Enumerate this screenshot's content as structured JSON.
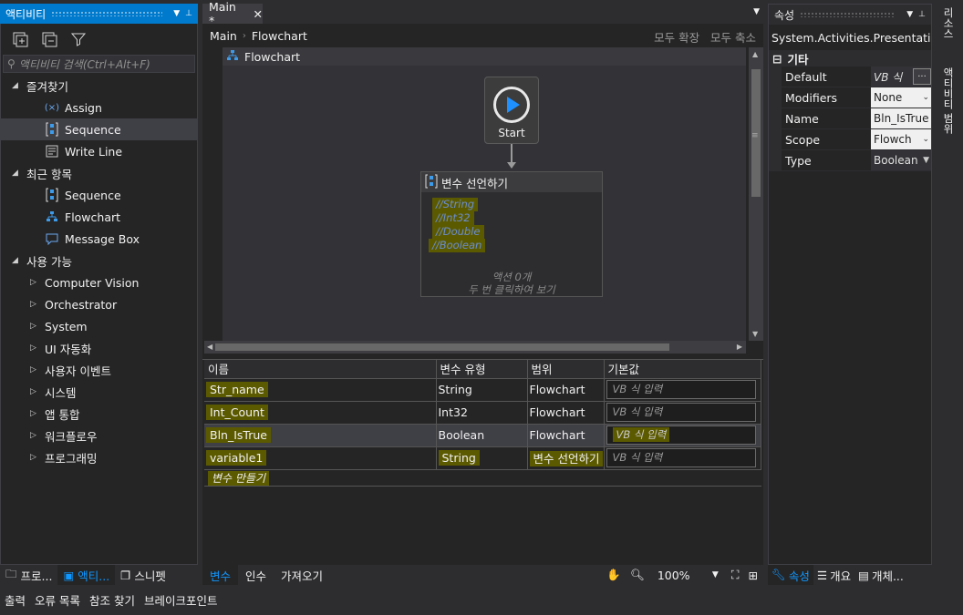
{
  "activities_panel": {
    "title": "액티비티",
    "search_placeholder": "액티비티 검색(Ctrl+Alt+F)",
    "tree": [
      {
        "type": "group",
        "label": "즐겨찾기",
        "expanded": true
      },
      {
        "type": "item",
        "icon": "assign-icon",
        "label": "Assign"
      },
      {
        "type": "item",
        "icon": "sequence-icon",
        "label": "Sequence",
        "selected": true
      },
      {
        "type": "item",
        "icon": "write-line-icon",
        "label": "Write Line"
      },
      {
        "type": "group",
        "label": "최근 항목",
        "expanded": true
      },
      {
        "type": "item",
        "icon": "sequence-icon",
        "label": "Sequence"
      },
      {
        "type": "item",
        "icon": "flowchart-icon",
        "label": "Flowchart"
      },
      {
        "type": "item",
        "icon": "message-box-icon",
        "label": "Message Box"
      },
      {
        "type": "group",
        "label": "사용 가능",
        "expanded": true
      },
      {
        "type": "sub",
        "label": "Computer Vision"
      },
      {
        "type": "sub",
        "label": "Orchestrator"
      },
      {
        "type": "sub",
        "label": "System"
      },
      {
        "type": "sub",
        "label": "UI 자동화"
      },
      {
        "type": "sub",
        "label": "사용자 이벤트"
      },
      {
        "type": "sub",
        "label": "시스템"
      },
      {
        "type": "sub",
        "label": "앱 통합"
      },
      {
        "type": "sub",
        "label": "워크플로우"
      },
      {
        "type": "sub",
        "label": "프로그래밍"
      }
    ],
    "bottom_tabs": [
      "프로...",
      "액티...",
      "스니펫"
    ]
  },
  "designer": {
    "tab_label": "Main *",
    "breadcrumb": [
      "Main",
      "Flowchart"
    ],
    "expand_all": "모두 확장",
    "collapse_all": "모두 축소",
    "flowchart_label": "Flowchart",
    "start_label": "Start",
    "sequence": {
      "title": "변수 선언하기",
      "comments": [
        "//String",
        "//Int32",
        "//Double",
        "//Boolean"
      ],
      "note_line1": "액션 0개",
      "note_line2": "두 번 클릭하여 보기"
    }
  },
  "variables": {
    "headers": [
      "이름",
      "변수 유형",
      "범위",
      "기본값"
    ],
    "rows": [
      {
        "name": "Str_name",
        "type": "String",
        "scope": "Flowchart",
        "default": "VB 식 입력"
      },
      {
        "name": "Int_Count",
        "type": "Int32",
        "scope": "Flowchart",
        "default": "VB 식 입력"
      },
      {
        "name": "Bln_IsTrue",
        "type": "Boolean",
        "scope": "Flowchart",
        "default": "VB 식 입력"
      },
      {
        "name": "variable1",
        "type": "String",
        "scope": "변수 선언하기",
        "default": "VB 식 입력"
      }
    ],
    "create_label": "변수 만들기",
    "bottom_tabs": [
      "변수",
      "인수",
      "가져오기"
    ],
    "zoom": "100%"
  },
  "properties": {
    "title": "속성",
    "type_name": "System.Activities.Presentatio...",
    "category": "기타",
    "rows": [
      {
        "name": "Default",
        "value": "VB 식",
        "kind": "dark"
      },
      {
        "name": "Modifiers",
        "value": "None",
        "kind": "dropdown"
      },
      {
        "name": "Name",
        "value": "Bln_IsTrue",
        "kind": "text"
      },
      {
        "name": "Scope",
        "value": "Flowch",
        "kind": "dropdown"
      },
      {
        "name": "Type",
        "value": "Boolean",
        "kind": "dark-dropdown"
      }
    ],
    "bottom_tabs": [
      "속성",
      "개요",
      "개체..."
    ]
  },
  "right_strip": [
    "리소스",
    "액티비티 범위"
  ],
  "status_bar": [
    "출력",
    "오류 목록",
    "참조 찾기",
    "브레이크포인트"
  ],
  "colors": {
    "accent": "#007acc",
    "highlight": "#5c5a00",
    "comment": "#6a8ed0",
    "active_tab": "#0e97ff"
  }
}
